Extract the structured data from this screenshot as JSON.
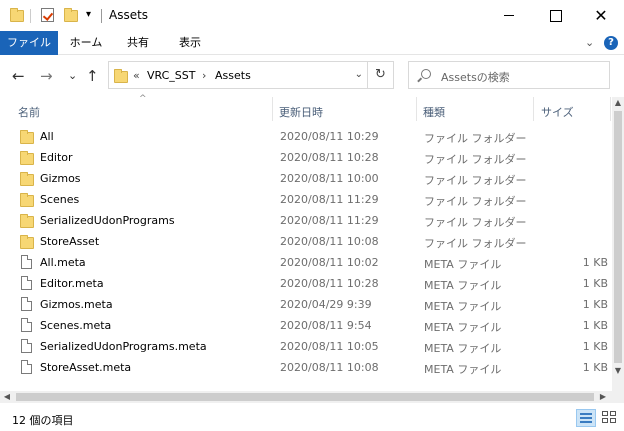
{
  "window": {
    "title": "Assets",
    "quick_access_dropdown": "▾",
    "minimize_icon": "minimize",
    "maximize_icon": "maximize",
    "close_icon": "✕"
  },
  "ribbon": {
    "tabs": [
      {
        "label": "ファイル",
        "active": true
      },
      {
        "label": "ホーム"
      },
      {
        "label": "共有"
      },
      {
        "label": "表示"
      }
    ],
    "expand_icon": "⌄",
    "help_icon": "?"
  },
  "nav": {
    "back_icon": "←",
    "forward_icon": "→",
    "recent_icon": "⌄",
    "up_icon": "↑",
    "breadcrumb_overflow": "«",
    "breadcrumb": [
      "VRC_SST",
      "Assets"
    ],
    "breadcrumb_separator": "›",
    "address_dropdown_icon": "⌄",
    "refresh_icon": "↻",
    "search_placeholder": "Assetsの検索"
  },
  "columns": {
    "sort_indicator": "^",
    "name": "名前",
    "date": "更新日時",
    "type": "種類",
    "size": "サイズ"
  },
  "files": [
    {
      "name": "All",
      "date": "2020/08/11 10:29",
      "type": "ファイル フォルダー",
      "size": "",
      "kind": "folder"
    },
    {
      "name": "Editor",
      "date": "2020/08/11 10:28",
      "type": "ファイル フォルダー",
      "size": "",
      "kind": "folder"
    },
    {
      "name": "Gizmos",
      "date": "2020/08/11 10:00",
      "type": "ファイル フォルダー",
      "size": "",
      "kind": "folder"
    },
    {
      "name": "Scenes",
      "date": "2020/08/11 11:29",
      "type": "ファイル フォルダー",
      "size": "",
      "kind": "folder"
    },
    {
      "name": "SerializedUdonPrograms",
      "date": "2020/08/11 11:29",
      "type": "ファイル フォルダー",
      "size": "",
      "kind": "folder"
    },
    {
      "name": "StoreAsset",
      "date": "2020/08/11 10:08",
      "type": "ファイル フォルダー",
      "size": "",
      "kind": "folder"
    },
    {
      "name": "All.meta",
      "date": "2020/08/11 10:02",
      "type": "META ファイル",
      "size": "1 KB",
      "kind": "file"
    },
    {
      "name": "Editor.meta",
      "date": "2020/08/11 10:28",
      "type": "META ファイル",
      "size": "1 KB",
      "kind": "file"
    },
    {
      "name": "Gizmos.meta",
      "date": "2020/04/29 9:39",
      "type": "META ファイル",
      "size": "1 KB",
      "kind": "file"
    },
    {
      "name": "Scenes.meta",
      "date": "2020/08/11 9:54",
      "type": "META ファイル",
      "size": "1 KB",
      "kind": "file"
    },
    {
      "name": "SerializedUdonPrograms.meta",
      "date": "2020/08/11 10:05",
      "type": "META ファイル",
      "size": "1 KB",
      "kind": "file"
    },
    {
      "name": "StoreAsset.meta",
      "date": "2020/08/11 10:08",
      "type": "META ファイル",
      "size": "1 KB",
      "kind": "file"
    }
  ],
  "status": {
    "item_count": "12 個の項目"
  },
  "colors": {
    "file_tab_bg": "#1a64b8",
    "folder_yellow": "#f7d774",
    "header_text": "#4c607a"
  }
}
